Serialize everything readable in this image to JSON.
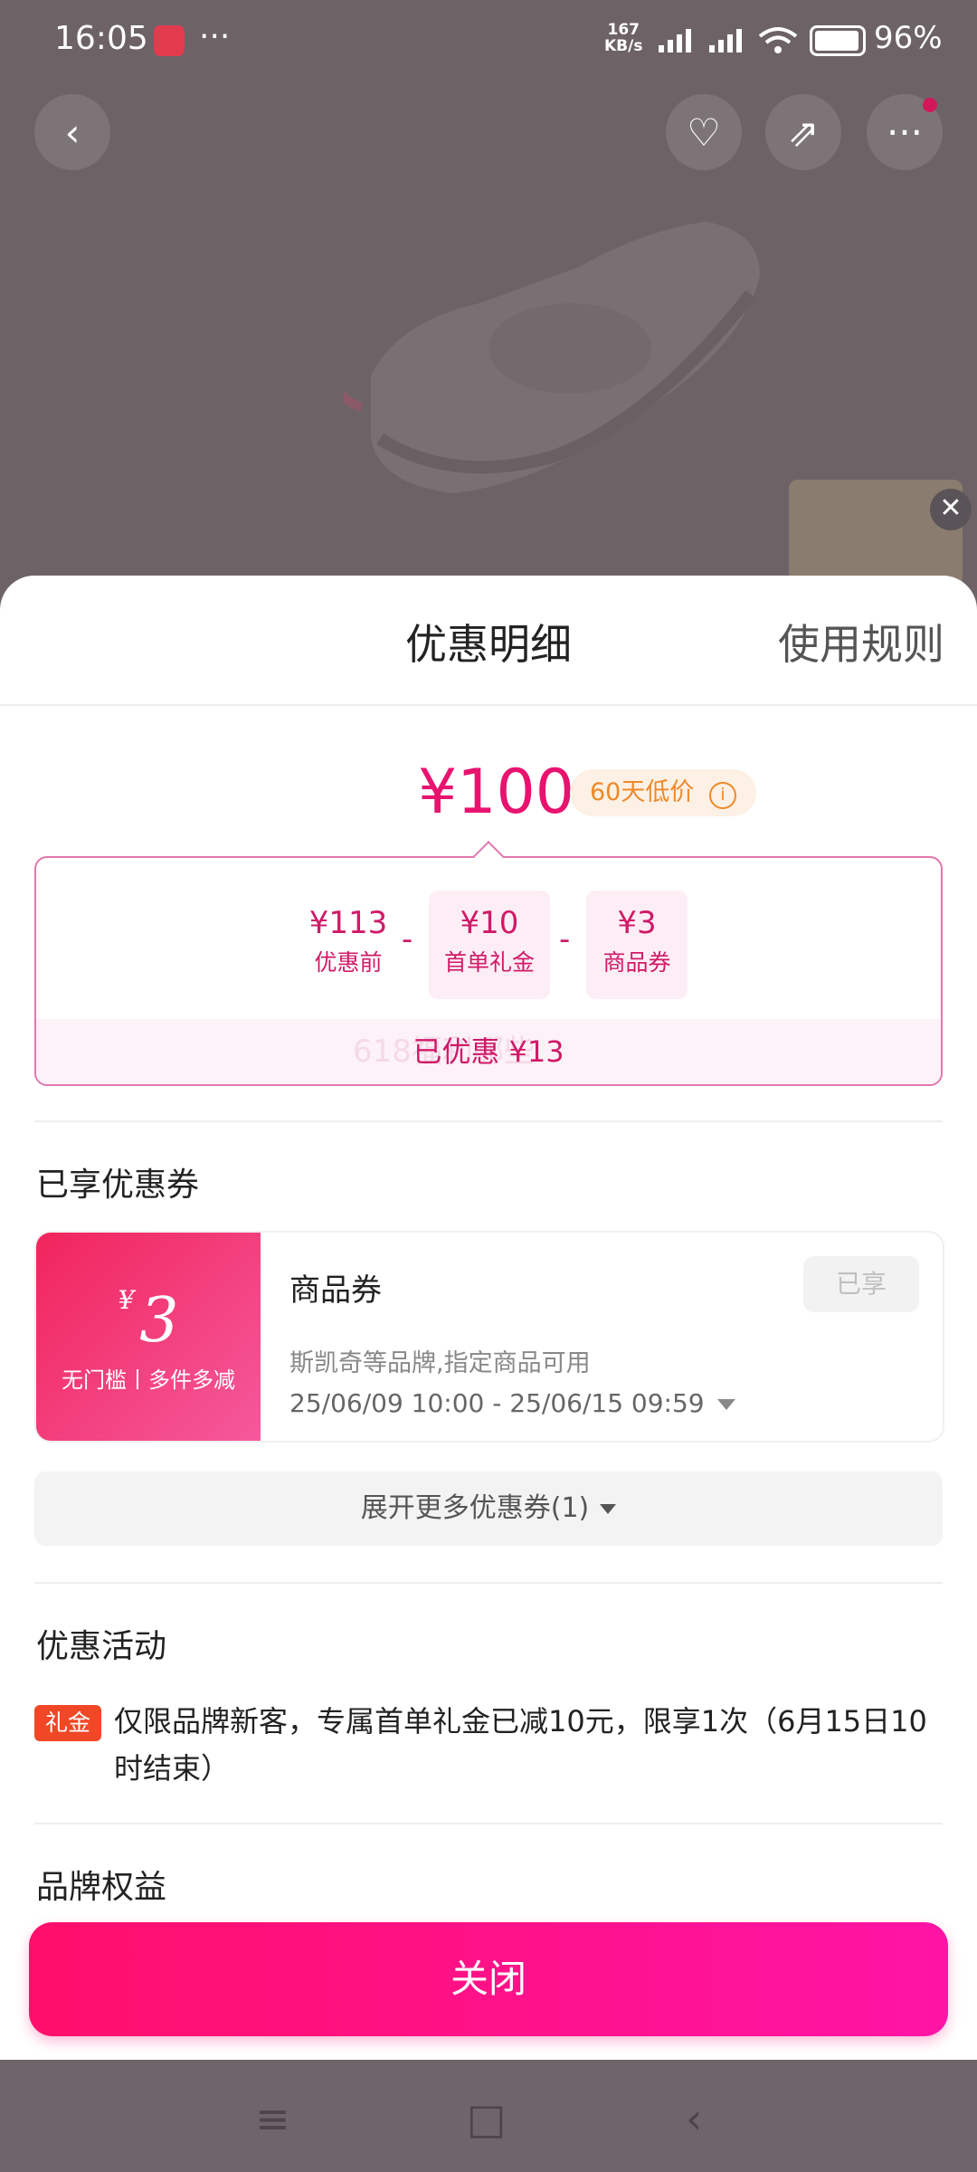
{
  "status_bar": {
    "time": "16:05",
    "more": "···",
    "net_speed_value": "167",
    "net_speed_unit": "KB/s",
    "battery": "96%"
  },
  "product_bg": {
    "back_icon": "‹",
    "fav_icon": "♡",
    "share_icon": "⇗",
    "more_icon": "···",
    "close_icon": "✕"
  },
  "sheet": {
    "title": "优惠明细",
    "rules_link": "使用规则",
    "final_price": "¥100",
    "low_price_badge": "60天低价",
    "info_icon": "i",
    "breakdown": [
      {
        "value": "¥113",
        "label": "优惠前"
      },
      {
        "value": "¥10",
        "label": "首单礼金"
      },
      {
        "value": "¥3",
        "label": "商品券"
      }
    ],
    "minus": "-",
    "saved": "已优惠 ¥13",
    "watermark": "618福利哪些"
  },
  "coupons_section": {
    "title": "已享优惠券",
    "coupon": {
      "currency": "¥",
      "amount": "3",
      "condition": "无门槛丨多件多减",
      "name": "商品券",
      "status": "已享",
      "description": "斯凯奇等品牌,指定商品可用",
      "validity": "25/06/09 10:00 - 25/06/15 09:59"
    },
    "expand_more": "展开更多优惠券(1)"
  },
  "activity_section": {
    "title": "优惠活动",
    "tag": "礼金",
    "text": "仅限品牌新客，专属首单礼金已减10元，限享1次（6月15日10时结束）"
  },
  "brand_section": {
    "title": "品牌权益"
  },
  "close_button": "关闭",
  "navbar": {
    "menu_icon": "≡",
    "home_icon": "□",
    "back_icon": "‹"
  },
  "colors": {
    "accent": "#e8136f",
    "button_gradient_start": "#ff0f6a",
    "button_gradient_end": "#ff14a6",
    "badge_orange": "#ee8a2a",
    "gift_tag": "#f04726"
  }
}
